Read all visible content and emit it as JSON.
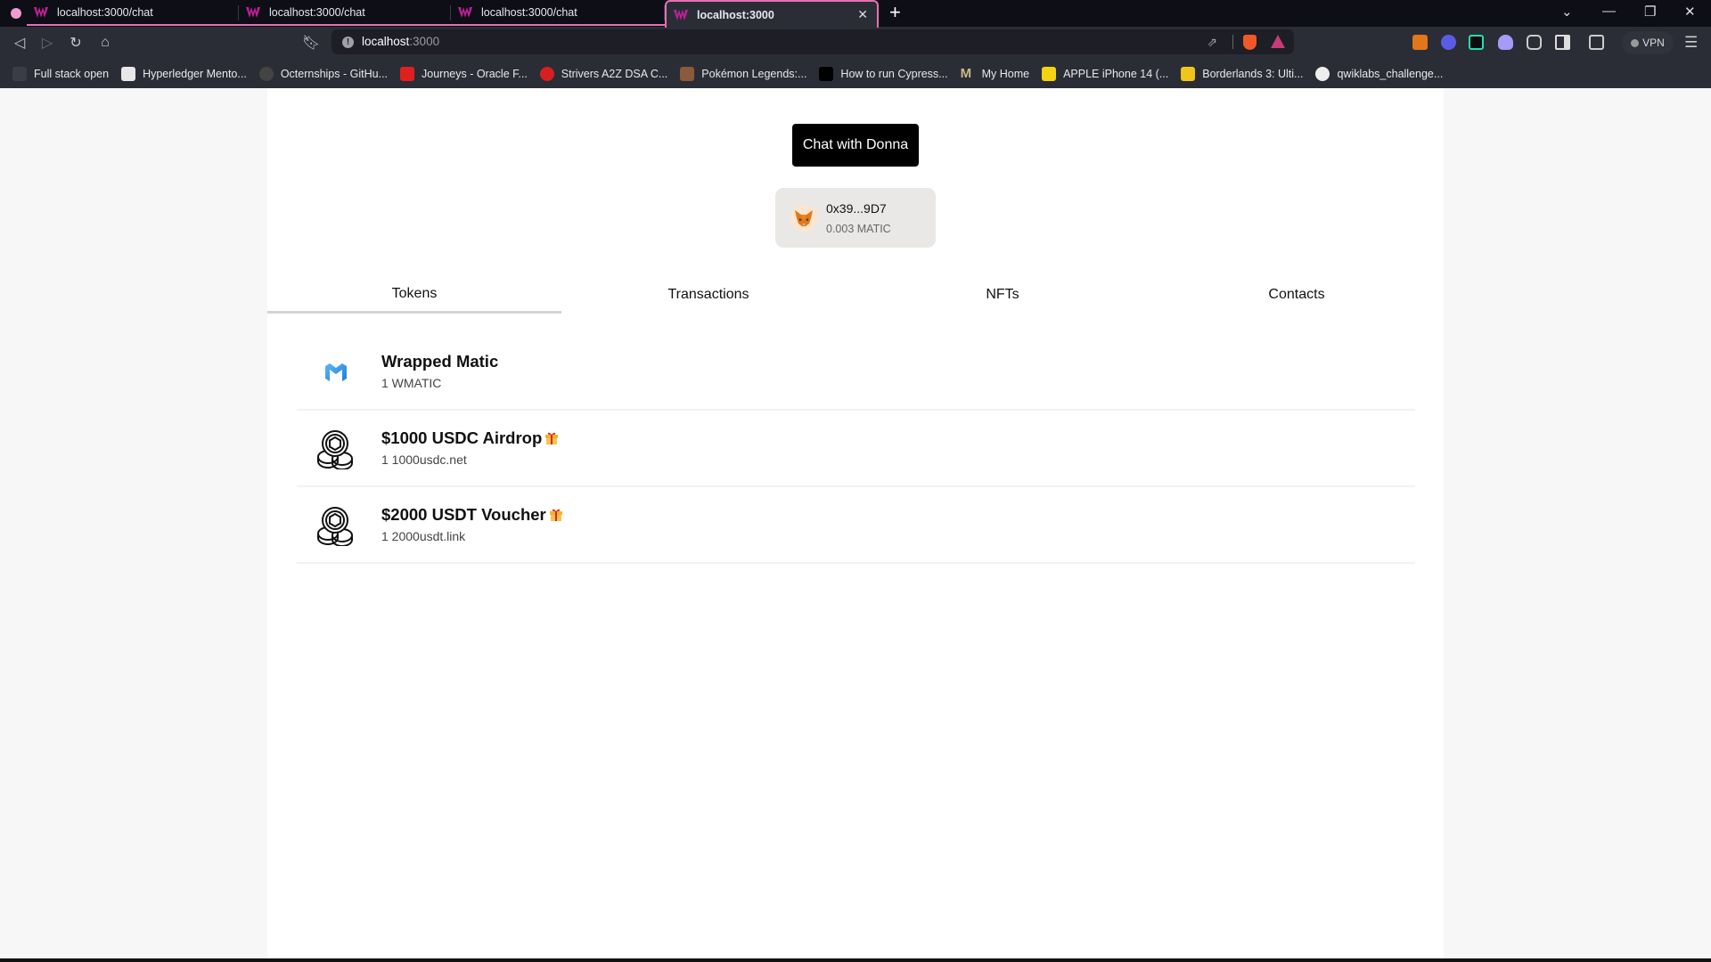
{
  "browser": {
    "tabs": [
      {
        "title": "localhost:3000/chat",
        "active": false
      },
      {
        "title": "localhost:3000/chat",
        "active": false
      },
      {
        "title": "localhost:3000/chat",
        "active": false
      },
      {
        "title": "localhost:3000",
        "active": true
      }
    ],
    "url_host": "localhost",
    "url_port": ":3000",
    "vpn_label": "VPN",
    "bookmarks": [
      {
        "label": "Full stack open",
        "icon": "blank-icon"
      },
      {
        "label": "Hyperledger Mento...",
        "icon": "hyperledger-icon"
      },
      {
        "label": "Octernships - GitHu...",
        "icon": "github-icon"
      },
      {
        "label": "Journeys - Oracle F...",
        "icon": "oracle-icon"
      },
      {
        "label": "Strivers A2Z DSA C...",
        "icon": "tuf-icon"
      },
      {
        "label": "Pokémon Legends:...",
        "icon": "pokemon-icon"
      },
      {
        "label": "How to run Cypress...",
        "icon": "medium-icon"
      },
      {
        "label": "My Home",
        "icon": "m-icon"
      },
      {
        "label": "APPLE iPhone 14 (...",
        "icon": "flipkart-icon"
      },
      {
        "label": "Borderlands 3: Ulti...",
        "icon": "borderlands-icon"
      },
      {
        "label": "qwiklabs_challenge...",
        "icon": "github-icon"
      }
    ],
    "colors": {
      "tab_accent": "#e86fb5"
    }
  },
  "app": {
    "chat_button": "Chat with Donna",
    "wallet": {
      "address": "0x39...9D7",
      "balance": "0.003 MATIC",
      "icon": "metamask-fox-icon"
    },
    "tabs": [
      "Tokens",
      "Transactions",
      "NFTs",
      "Contacts"
    ],
    "active_tab": "Tokens",
    "tokens": [
      {
        "name": "Wrapped Matic",
        "amount": "1 WMATIC",
        "icon": "polygon-matic-icon",
        "gift": false
      },
      {
        "name": "$1000 USDC Airdrop",
        "amount": "1 1000usdc.net",
        "icon": "coins-stack-icon",
        "gift": true
      },
      {
        "name": "$2000 USDT Voucher",
        "amount": "1 2000usdt.link",
        "icon": "coins-stack-icon",
        "gift": true
      }
    ]
  }
}
